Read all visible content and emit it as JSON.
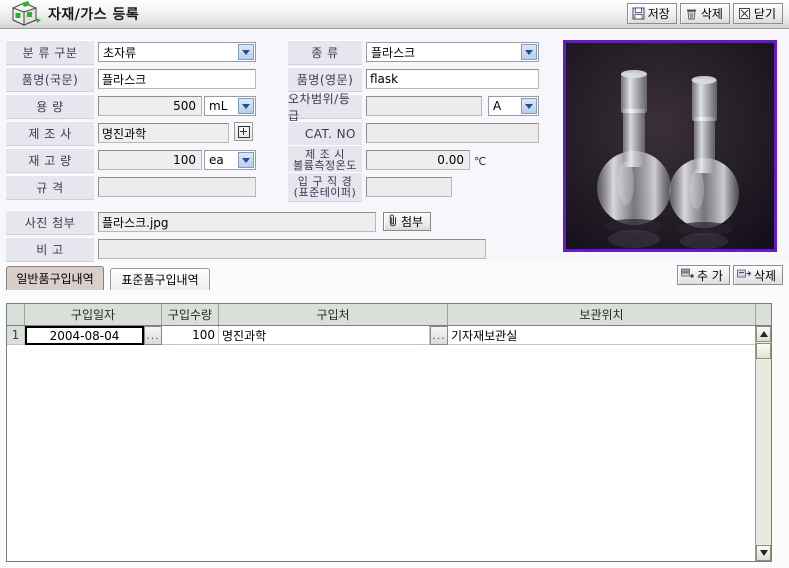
{
  "window": {
    "title": "자재/가스 등록",
    "icon": "box-cube-icon",
    "buttons": [
      {
        "label": "저장",
        "icon": "save-floppy-icon"
      },
      {
        "label": "삭제",
        "icon": "trash-icon"
      },
      {
        "label": "닫기",
        "icon": "close-x-icon"
      }
    ]
  },
  "form": {
    "classification": {
      "label": "분 류 구분",
      "value": "초자류"
    },
    "kind": {
      "label": "종      류",
      "value": "플라스크"
    },
    "name_ko": {
      "label": "품명(국문)",
      "value": "플라스크"
    },
    "name_en": {
      "label": "품명(영문)",
      "value": "flask"
    },
    "capacity": {
      "label": "용      량",
      "value": "500",
      "unit": "mL"
    },
    "tolerance": {
      "label": "오차범위/등급",
      "value": "",
      "grade": "A"
    },
    "maker": {
      "label": "제  조  사",
      "value": "명진과학",
      "picker_icon": "add-box-icon"
    },
    "cat_no": {
      "label": "CAT. NO",
      "value": ""
    },
    "stock": {
      "label": "재 고 량",
      "value": "100",
      "unit": "ea"
    },
    "temp": {
      "label_line1": "제   조   시",
      "label_line2": "볼륨측정온도",
      "value": "0.00",
      "unit": "℃"
    },
    "spec": {
      "label": "규      격",
      "value": ""
    },
    "neck": {
      "label_line1": "입 구 직 경",
      "label_line2": "(표준테이퍼)",
      "value": ""
    },
    "photo": {
      "label": "사진 첨부",
      "value": "플라스크.jpg",
      "button": "첨부",
      "button_icon": "paperclip-icon"
    },
    "remark": {
      "label": "비      고",
      "value": ""
    },
    "preview_alt": "두 개의 둥근바닥 플라스크 사진"
  },
  "tabs": [
    {
      "label": "일반품구입내역",
      "active": true
    },
    {
      "label": "표준품구입내역",
      "active": false
    }
  ],
  "row_actions": [
    {
      "label": "추 가",
      "icon": "row-add-icon"
    },
    {
      "label": "삭제",
      "icon": "row-delete-icon"
    }
  ],
  "grid": {
    "columns": [
      "",
      "구입일자",
      "구입수량",
      "구입처",
      "보관위치"
    ],
    "rows": [
      {
        "index": "1",
        "purchase_date": "2004-08-04",
        "date_picker": "...",
        "quantity": "100",
        "supplier": "명진과학",
        "supplier_picker": "...",
        "location": "기자재보관실"
      }
    ]
  },
  "colors": {
    "label_bg": "#e6e6ee",
    "form_bg": "#f7f7fb",
    "photo_border": "#6619cc",
    "tab_active_bg": "#d8cfca",
    "grid_header_bg": "#d9dfd9",
    "dropdown_arrow": "#1d4f91"
  }
}
